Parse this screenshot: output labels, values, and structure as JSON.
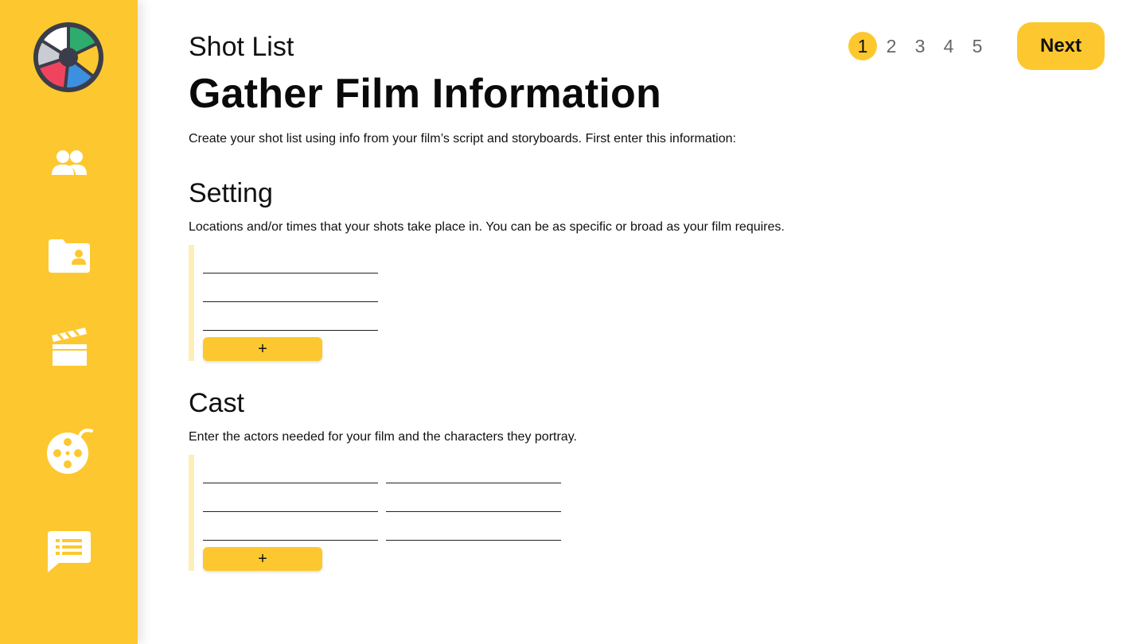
{
  "sidebar": {
    "logo_icon": "camera-aperture-logo",
    "items": [
      {
        "name": "people",
        "icon": "people-icon"
      },
      {
        "name": "folder",
        "icon": "folder-contact-icon"
      },
      {
        "name": "clapperboard",
        "icon": "clapperboard-icon"
      },
      {
        "name": "film-reel",
        "icon": "film-reel-icon"
      },
      {
        "name": "comments",
        "icon": "chat-list-icon"
      }
    ],
    "colors": {
      "background": "#fdc82f",
      "icon": "#ffffff"
    }
  },
  "header": {
    "eyebrow": "Shot List",
    "title": "Gather Film Information",
    "intro": "Create your shot list using info from your film’s script and storyboards. First enter this information:"
  },
  "stepper": {
    "steps": [
      "1",
      "2",
      "3",
      "4",
      "5"
    ],
    "active": "1"
  },
  "next_button": {
    "label": "Next"
  },
  "setting": {
    "title": "Setting",
    "description": "Locations and/or times that your shots take place in. You can be as specific or broad as your film requires.",
    "rows": [
      [
        ""
      ],
      [
        ""
      ],
      [
        ""
      ]
    ],
    "add_label": "+"
  },
  "cast": {
    "title": "Cast",
    "description": "Enter the actors needed for your film and the characters they portray.",
    "rows": [
      [
        "",
        ""
      ],
      [
        "",
        ""
      ],
      [
        "",
        ""
      ]
    ],
    "add_label": "+"
  },
  "colors": {
    "accent": "#fdc82f",
    "field_bar": "#fcefb7"
  }
}
